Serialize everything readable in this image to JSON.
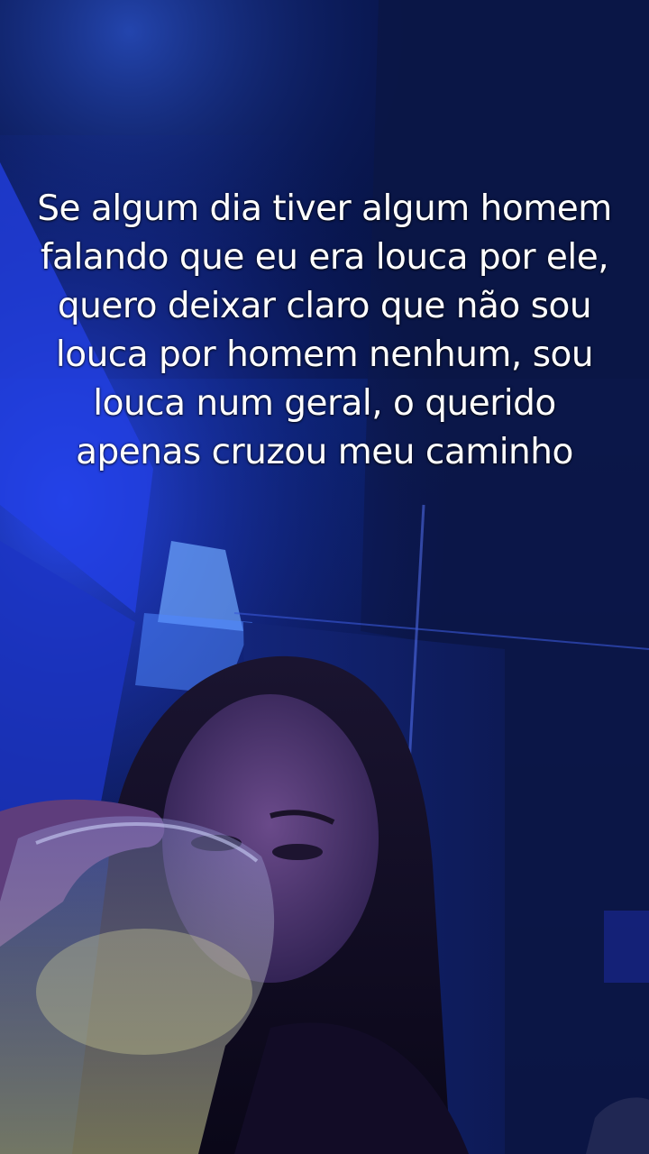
{
  "overlay_text": {
    "caption": "Se algum dia tiver algum homem falando que eu era louca por ele, quero deixar claro que não sou louca por homem nenhum, sou louca num geral, o querido apenas cruzou meu caminho"
  },
  "colors": {
    "background_dark": "#040a2a",
    "neon_blue": "#1a3cff",
    "caption_text": "#ffffff"
  }
}
